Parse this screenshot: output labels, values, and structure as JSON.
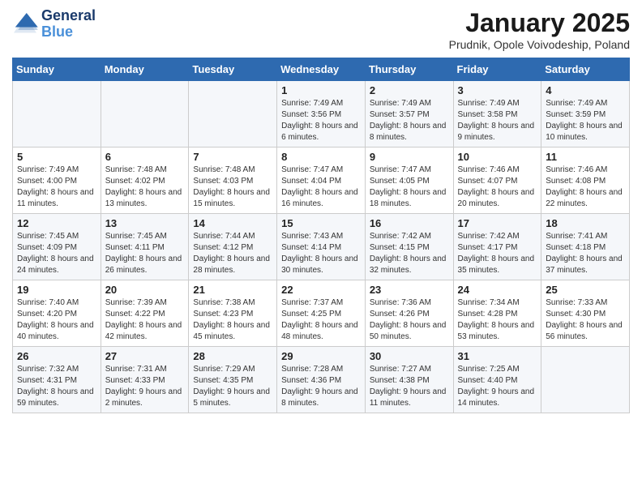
{
  "header": {
    "logo_line1": "General",
    "logo_line2": "Blue",
    "month": "January 2025",
    "location": "Prudnik, Opole Voivodeship, Poland"
  },
  "weekdays": [
    "Sunday",
    "Monday",
    "Tuesday",
    "Wednesday",
    "Thursday",
    "Friday",
    "Saturday"
  ],
  "weeks": [
    [
      {
        "day": "",
        "info": ""
      },
      {
        "day": "",
        "info": ""
      },
      {
        "day": "",
        "info": ""
      },
      {
        "day": "1",
        "info": "Sunrise: 7:49 AM\nSunset: 3:56 PM\nDaylight: 8 hours and 6 minutes."
      },
      {
        "day": "2",
        "info": "Sunrise: 7:49 AM\nSunset: 3:57 PM\nDaylight: 8 hours and 8 minutes."
      },
      {
        "day": "3",
        "info": "Sunrise: 7:49 AM\nSunset: 3:58 PM\nDaylight: 8 hours and 9 minutes."
      },
      {
        "day": "4",
        "info": "Sunrise: 7:49 AM\nSunset: 3:59 PM\nDaylight: 8 hours and 10 minutes."
      }
    ],
    [
      {
        "day": "5",
        "info": "Sunrise: 7:49 AM\nSunset: 4:00 PM\nDaylight: 8 hours and 11 minutes."
      },
      {
        "day": "6",
        "info": "Sunrise: 7:48 AM\nSunset: 4:02 PM\nDaylight: 8 hours and 13 minutes."
      },
      {
        "day": "7",
        "info": "Sunrise: 7:48 AM\nSunset: 4:03 PM\nDaylight: 8 hours and 15 minutes."
      },
      {
        "day": "8",
        "info": "Sunrise: 7:47 AM\nSunset: 4:04 PM\nDaylight: 8 hours and 16 minutes."
      },
      {
        "day": "9",
        "info": "Sunrise: 7:47 AM\nSunset: 4:05 PM\nDaylight: 8 hours and 18 minutes."
      },
      {
        "day": "10",
        "info": "Sunrise: 7:46 AM\nSunset: 4:07 PM\nDaylight: 8 hours and 20 minutes."
      },
      {
        "day": "11",
        "info": "Sunrise: 7:46 AM\nSunset: 4:08 PM\nDaylight: 8 hours and 22 minutes."
      }
    ],
    [
      {
        "day": "12",
        "info": "Sunrise: 7:45 AM\nSunset: 4:09 PM\nDaylight: 8 hours and 24 minutes."
      },
      {
        "day": "13",
        "info": "Sunrise: 7:45 AM\nSunset: 4:11 PM\nDaylight: 8 hours and 26 minutes."
      },
      {
        "day": "14",
        "info": "Sunrise: 7:44 AM\nSunset: 4:12 PM\nDaylight: 8 hours and 28 minutes."
      },
      {
        "day": "15",
        "info": "Sunrise: 7:43 AM\nSunset: 4:14 PM\nDaylight: 8 hours and 30 minutes."
      },
      {
        "day": "16",
        "info": "Sunrise: 7:42 AM\nSunset: 4:15 PM\nDaylight: 8 hours and 32 minutes."
      },
      {
        "day": "17",
        "info": "Sunrise: 7:42 AM\nSunset: 4:17 PM\nDaylight: 8 hours and 35 minutes."
      },
      {
        "day": "18",
        "info": "Sunrise: 7:41 AM\nSunset: 4:18 PM\nDaylight: 8 hours and 37 minutes."
      }
    ],
    [
      {
        "day": "19",
        "info": "Sunrise: 7:40 AM\nSunset: 4:20 PM\nDaylight: 8 hours and 40 minutes."
      },
      {
        "day": "20",
        "info": "Sunrise: 7:39 AM\nSunset: 4:22 PM\nDaylight: 8 hours and 42 minutes."
      },
      {
        "day": "21",
        "info": "Sunrise: 7:38 AM\nSunset: 4:23 PM\nDaylight: 8 hours and 45 minutes."
      },
      {
        "day": "22",
        "info": "Sunrise: 7:37 AM\nSunset: 4:25 PM\nDaylight: 8 hours and 48 minutes."
      },
      {
        "day": "23",
        "info": "Sunrise: 7:36 AM\nSunset: 4:26 PM\nDaylight: 8 hours and 50 minutes."
      },
      {
        "day": "24",
        "info": "Sunrise: 7:34 AM\nSunset: 4:28 PM\nDaylight: 8 hours and 53 minutes."
      },
      {
        "day": "25",
        "info": "Sunrise: 7:33 AM\nSunset: 4:30 PM\nDaylight: 8 hours and 56 minutes."
      }
    ],
    [
      {
        "day": "26",
        "info": "Sunrise: 7:32 AM\nSunset: 4:31 PM\nDaylight: 8 hours and 59 minutes."
      },
      {
        "day": "27",
        "info": "Sunrise: 7:31 AM\nSunset: 4:33 PM\nDaylight: 9 hours and 2 minutes."
      },
      {
        "day": "28",
        "info": "Sunrise: 7:29 AM\nSunset: 4:35 PM\nDaylight: 9 hours and 5 minutes."
      },
      {
        "day": "29",
        "info": "Sunrise: 7:28 AM\nSunset: 4:36 PM\nDaylight: 9 hours and 8 minutes."
      },
      {
        "day": "30",
        "info": "Sunrise: 7:27 AM\nSunset: 4:38 PM\nDaylight: 9 hours and 11 minutes."
      },
      {
        "day": "31",
        "info": "Sunrise: 7:25 AM\nSunset: 4:40 PM\nDaylight: 9 hours and 14 minutes."
      },
      {
        "day": "",
        "info": ""
      }
    ]
  ]
}
